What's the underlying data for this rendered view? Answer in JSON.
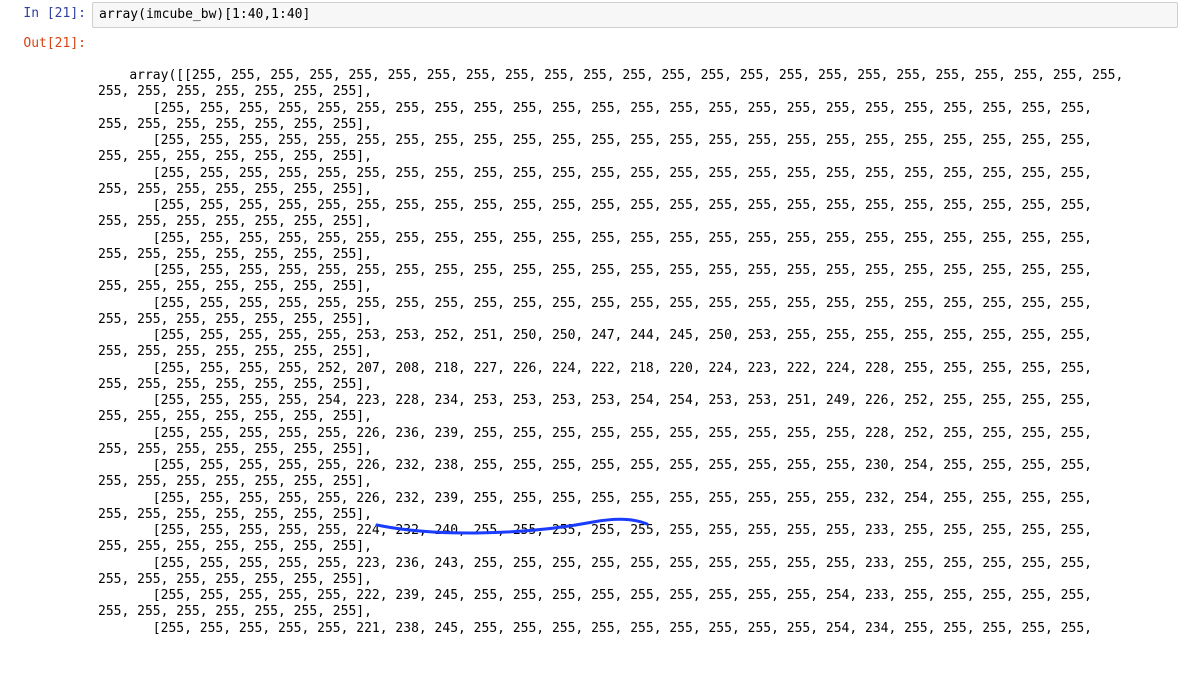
{
  "in_prompt": "In [21]:",
  "out_prompt": "Out[21]:",
  "input_code": "array(imcube_bw)[1:40,1:40]",
  "array_prefix": "array(",
  "row_tail": "255, 255, 255, 255, 255, 255, 255],",
  "rows": [
    "[255, 255, 255, 255, 255, 255, 255, 255, 255, 255, 255, 255, 255, 255, 255, 255, 255, 255, 255, 255, 255, 255, 255, 255,",
    "[255, 255, 255, 255, 255, 255, 255, 255, 255, 255, 255, 255, 255, 255, 255, 255, 255, 255, 255, 255, 255, 255, 255, 255,",
    "[255, 255, 255, 255, 255, 255, 255, 255, 255, 255, 255, 255, 255, 255, 255, 255, 255, 255, 255, 255, 255, 255, 255, 255,",
    "[255, 255, 255, 255, 255, 255, 255, 255, 255, 255, 255, 255, 255, 255, 255, 255, 255, 255, 255, 255, 255, 255, 255, 255,",
    "[255, 255, 255, 255, 255, 255, 255, 255, 255, 255, 255, 255, 255, 255, 255, 255, 255, 255, 255, 255, 255, 255, 255, 255,",
    "[255, 255, 255, 255, 255, 255, 255, 255, 255, 255, 255, 255, 255, 255, 255, 255, 255, 255, 255, 255, 255, 255, 255, 255,",
    "[255, 255, 255, 255, 255, 255, 255, 255, 255, 255, 255, 255, 255, 255, 255, 255, 255, 255, 255, 255, 255, 255, 255, 255,",
    "[255, 255, 255, 255, 255, 255, 255, 255, 255, 255, 255, 255, 255, 255, 255, 255, 255, 255, 255, 255, 255, 255, 255, 255,",
    "[255, 255, 255, 255, 255, 253, 253, 252, 251, 250, 250, 247, 244, 245, 250, 253, 255, 255, 255, 255, 255, 255, 255, 255,",
    "[255, 255, 255, 255, 252, 207, 208, 218, 227, 226, 224, 222, 218, 220, 224, 223, 222, 224, 228, 255, 255, 255, 255, 255,",
    "[255, 255, 255, 255, 254, 223, 228, 234, 253, 253, 253, 253, 254, 254, 253, 253, 251, 249, 226, 252, 255, 255, 255, 255,",
    "[255, 255, 255, 255, 255, 226, 236, 239, 255, 255, 255, 255, 255, 255, 255, 255, 255, 255, 228, 252, 255, 255, 255, 255,",
    "[255, 255, 255, 255, 255, 226, 232, 238, 255, 255, 255, 255, 255, 255, 255, 255, 255, 255, 230, 254, 255, 255, 255, 255,",
    "[255, 255, 255, 255, 255, 226, 232, 239, 255, 255, 255, 255, 255, 255, 255, 255, 255, 255, 232, 254, 255, 255, 255, 255,",
    "[255, 255, 255, 255, 255, 224, 232, 240, 255, 255, 255, 255, 255, 255, 255, 255, 255, 255, 233, 255, 255, 255, 255, 255,",
    "[255, 255, 255, 255, 255, 223, 236, 243, 255, 255, 255, 255, 255, 255, 255, 255, 255, 255, 233, 255, 255, 255, 255, 255,",
    "[255, 255, 255, 255, 255, 222, 239, 245, 255, 255, 255, 255, 255, 255, 255, 255, 255, 254, 233, 255, 255, 255, 255, 255,",
    "[255, 255, 255, 255, 255, 221, 238, 245, 255, 255, 255, 255, 255, 255, 255, 255, 255, 254, 234, 255, 255, 255, 255, 255,"
  ],
  "last_row_no_tail": true,
  "annotation_stroke": "#1a3cff"
}
